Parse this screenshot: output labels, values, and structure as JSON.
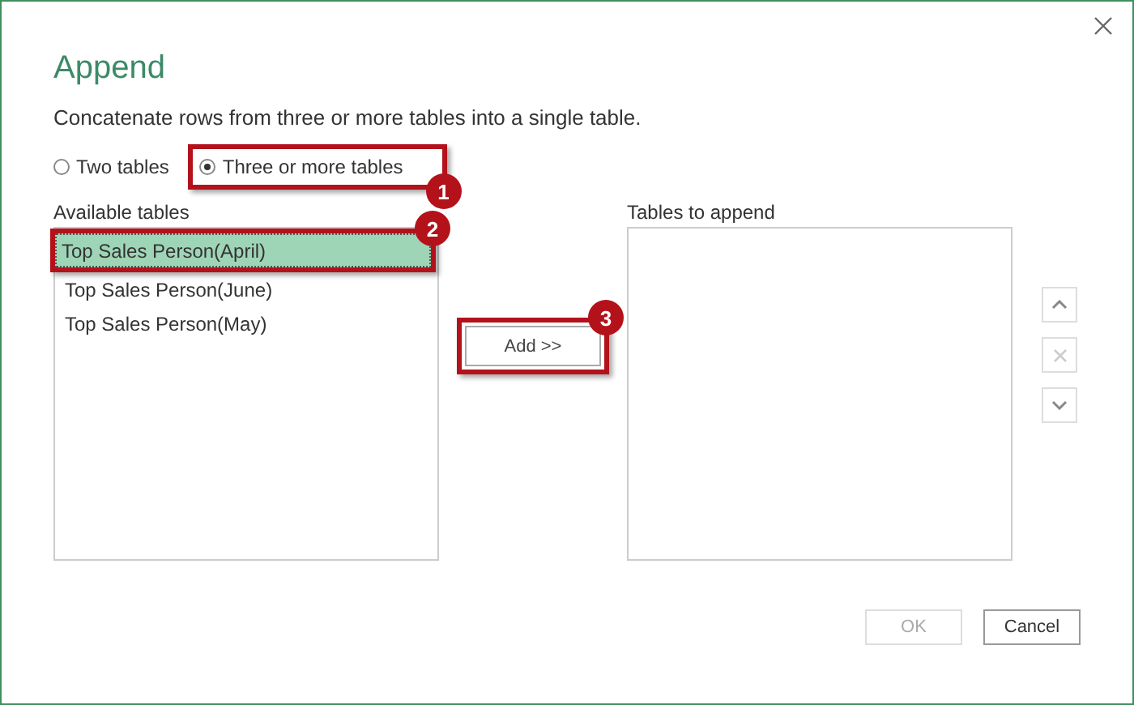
{
  "dialog": {
    "title": "Append",
    "description": "Concatenate rows from three or more tables into a single table.",
    "mode_options": [
      {
        "label": "Two tables",
        "selected": false
      },
      {
        "label": "Three or more tables",
        "selected": true,
        "callout": "1"
      }
    ],
    "available_tables": {
      "label": "Available tables",
      "items": [
        {
          "label": "Top Sales Person(April)",
          "selected": true,
          "callout": "2"
        },
        {
          "label": "Top Sales Person(June)",
          "selected": false
        },
        {
          "label": "Top Sales Person(May)",
          "selected": false
        }
      ]
    },
    "add_button": {
      "label": "Add >>",
      "callout": "3"
    },
    "tables_to_append": {
      "label": "Tables to append"
    },
    "move_buttons": [
      {
        "kind": "up",
        "disabled": false
      },
      {
        "kind": "remove",
        "disabled": true
      },
      {
        "kind": "down",
        "disabled": false
      }
    ],
    "buttons": [
      {
        "label": "OK",
        "disabled": true
      },
      {
        "label": "Cancel",
        "disabled": false
      }
    ]
  }
}
